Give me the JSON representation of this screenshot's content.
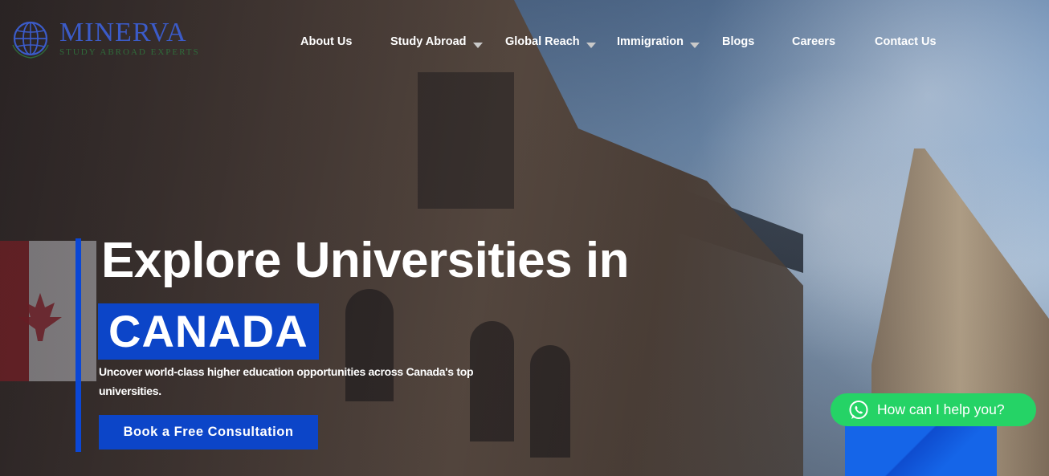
{
  "brand": {
    "title": "MINERVA",
    "subtitle": "STUDY ABROAD EXPERTS",
    "logo_icon": "globe-icon",
    "title_color": "#3b5bc8",
    "subtitle_color": "#2f6b3a"
  },
  "nav": {
    "items": [
      {
        "label": "About Us",
        "has_dropdown": false
      },
      {
        "label": "Study Abroad",
        "has_dropdown": true
      },
      {
        "label": "Global Reach",
        "has_dropdown": true
      },
      {
        "label": "Immigration",
        "has_dropdown": true
      },
      {
        "label": "Blogs",
        "has_dropdown": false
      },
      {
        "label": "Careers",
        "has_dropdown": false
      },
      {
        "label": "Contact Us",
        "has_dropdown": false
      }
    ]
  },
  "hero": {
    "headline": "Explore Universities in",
    "highlight": "CANADA",
    "description": "Uncover world-class higher education opportunities across Canada's top universities.",
    "cta_label": "Book a Free Consultation",
    "accent_color": "#0c45c8"
  },
  "chat": {
    "label": "How can I help you?",
    "icon": "whatsapp-icon",
    "color": "#25d366"
  }
}
